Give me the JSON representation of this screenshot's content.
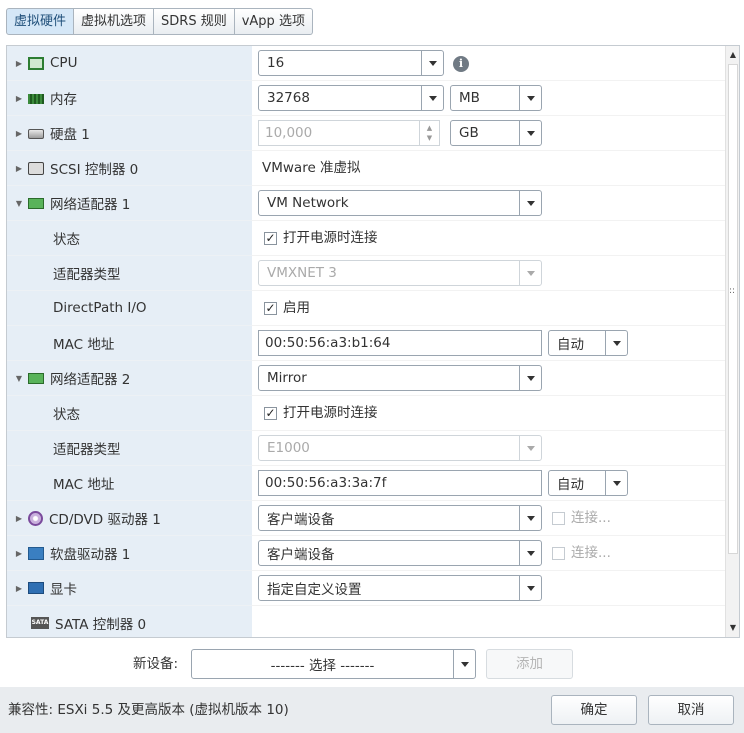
{
  "tabs": [
    "虚拟硬件",
    "虚拟机选项",
    "SDRS 规则",
    "vApp 选项"
  ],
  "rows": {
    "cpu": {
      "label": "CPU",
      "value": "16"
    },
    "memory": {
      "label": "内存",
      "value": "32768",
      "unit": "MB"
    },
    "disk": {
      "label": "硬盘 1",
      "value": "10,000",
      "unit": "GB"
    },
    "scsi": {
      "label": "SCSI 控制器 0",
      "value": "VMware 准虚拟"
    },
    "nic1": {
      "label": "网络适配器 1",
      "network": "VM Network",
      "status_label": "状态",
      "status_value": "打开电源时连接",
      "status_checked": true,
      "type_label": "适配器类型",
      "type_value": "VMXNET 3",
      "directpath_label": "DirectPath I/O",
      "directpath_value": "启用",
      "directpath_checked": true,
      "mac_label": "MAC 地址",
      "mac_value": "00:50:56:a3:b1:64",
      "mac_mode": "自动"
    },
    "nic2": {
      "label": "网络适配器 2",
      "network": "Mirror",
      "status_label": "状态",
      "status_value": "打开电源时连接",
      "status_checked": true,
      "type_label": "适配器类型",
      "type_value": "E1000",
      "mac_label": "MAC 地址",
      "mac_value": "00:50:56:a3:3a:7f",
      "mac_mode": "自动"
    },
    "cdrom": {
      "label": "CD/DVD 驱动器 1",
      "value": "客户端设备",
      "connect": "连接..."
    },
    "floppy": {
      "label": "软盘驱动器 1",
      "value": "客户端设备",
      "connect": "连接..."
    },
    "video": {
      "label": "显卡",
      "value": "指定自定义设置"
    },
    "sata": {
      "label": "SATA 控制器 0"
    }
  },
  "new_device": {
    "label": "新设备:",
    "select": "------- 选择 -------",
    "add": "添加"
  },
  "footer": {
    "compat": "兼容性: ESXi 5.5 及更高版本 (虚拟机版本 10)",
    "ok": "确定",
    "cancel": "取消"
  },
  "icons": {
    "cpu": "cpu-icon",
    "info": "info-icon",
    "memory": "memory-icon",
    "disk": "hard-disk-icon",
    "scsi": "scsi-controller-icon",
    "nic": "network-adapter-icon",
    "cdrom": "cd-dvd-icon",
    "floppy": "floppy-icon",
    "video": "video-card-icon",
    "sata": "sata-controller-icon"
  }
}
